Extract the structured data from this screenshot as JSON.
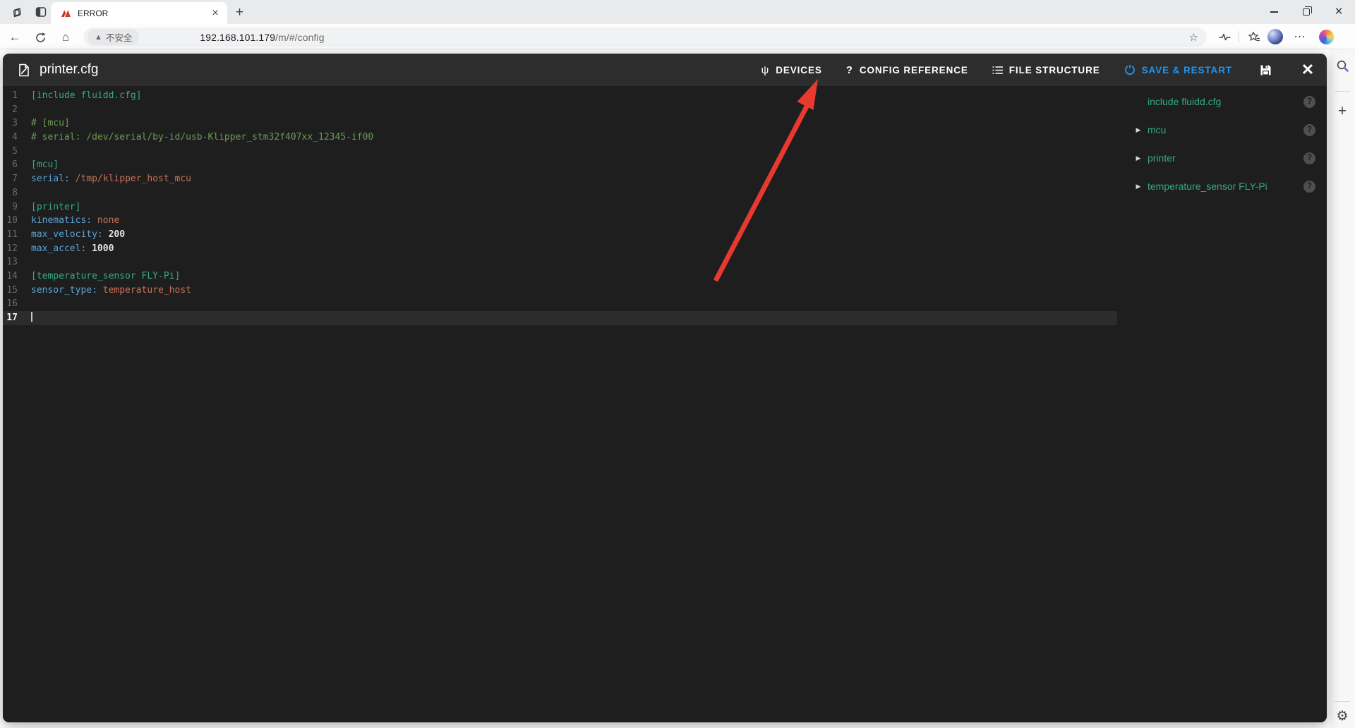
{
  "browser": {
    "tab": {
      "title": "ERROR"
    },
    "address": {
      "security_label": "不安全",
      "url_host": "192.168.101.179",
      "url_path": "/m/#/config"
    }
  },
  "editor": {
    "title": "printer.cfg",
    "toolbar": {
      "devices": "DEVICES",
      "config_reference": "CONFIG REFERENCE",
      "file_structure": "FILE STRUCTURE",
      "save_restart": "SAVE & RESTART"
    },
    "code": {
      "active_line": 17,
      "lines": [
        {
          "n": 1,
          "tokens": [
            {
              "t": "section",
              "v": "[include fluidd.cfg]"
            }
          ]
        },
        {
          "n": 2,
          "tokens": []
        },
        {
          "n": 3,
          "tokens": [
            {
              "t": "comment",
              "v": "# [mcu]"
            }
          ]
        },
        {
          "n": 4,
          "tokens": [
            {
              "t": "comment",
              "v": "# serial: /dev/serial/by-id/usb-Klipper_stm32f407xx_12345-if00"
            }
          ]
        },
        {
          "n": 5,
          "tokens": []
        },
        {
          "n": 6,
          "tokens": [
            {
              "t": "section",
              "v": "[mcu]"
            }
          ]
        },
        {
          "n": 7,
          "tokens": [
            {
              "t": "key",
              "v": "serial:"
            },
            {
              "t": "plain",
              "v": " "
            },
            {
              "t": "string",
              "v": "/tmp/klipper_host_mcu"
            }
          ]
        },
        {
          "n": 8,
          "tokens": []
        },
        {
          "n": 9,
          "tokens": [
            {
              "t": "section",
              "v": "[printer]"
            }
          ]
        },
        {
          "n": 10,
          "tokens": [
            {
              "t": "key",
              "v": "kinematics:"
            },
            {
              "t": "plain",
              "v": " "
            },
            {
              "t": "string",
              "v": "none"
            }
          ]
        },
        {
          "n": 11,
          "tokens": [
            {
              "t": "key",
              "v": "max_velocity:"
            },
            {
              "t": "plain",
              "v": " "
            },
            {
              "t": "number",
              "v": "200"
            }
          ]
        },
        {
          "n": 12,
          "tokens": [
            {
              "t": "key",
              "v": "max_accel:"
            },
            {
              "t": "plain",
              "v": " "
            },
            {
              "t": "number",
              "v": "1000"
            }
          ]
        },
        {
          "n": 13,
          "tokens": []
        },
        {
          "n": 14,
          "tokens": [
            {
              "t": "section",
              "v": "[temperature_sensor FLY-Pi]"
            }
          ]
        },
        {
          "n": 15,
          "tokens": [
            {
              "t": "key",
              "v": "sensor_type:"
            },
            {
              "t": "plain",
              "v": " "
            },
            {
              "t": "string",
              "v": "temperature_host"
            }
          ]
        },
        {
          "n": 16,
          "tokens": []
        },
        {
          "n": 17,
          "tokens": []
        }
      ]
    }
  },
  "tree": {
    "items": [
      {
        "label": "include fluidd.cfg",
        "expandable": false
      },
      {
        "label": "mcu",
        "expandable": true
      },
      {
        "label": "printer",
        "expandable": true
      },
      {
        "label": "temperature_sensor FLY-Pi",
        "expandable": true
      }
    ]
  },
  "colors": {
    "accent_blue": "#2196f3",
    "section_green": "#35a985",
    "comment_green": "#6a9955",
    "key_blue": "#5ba3d6",
    "string_orange": "#c7705a",
    "annotation_red": "#e8392f",
    "modal_bg": "#1e1e1e",
    "modal_header_bg": "#2d2d2d"
  }
}
